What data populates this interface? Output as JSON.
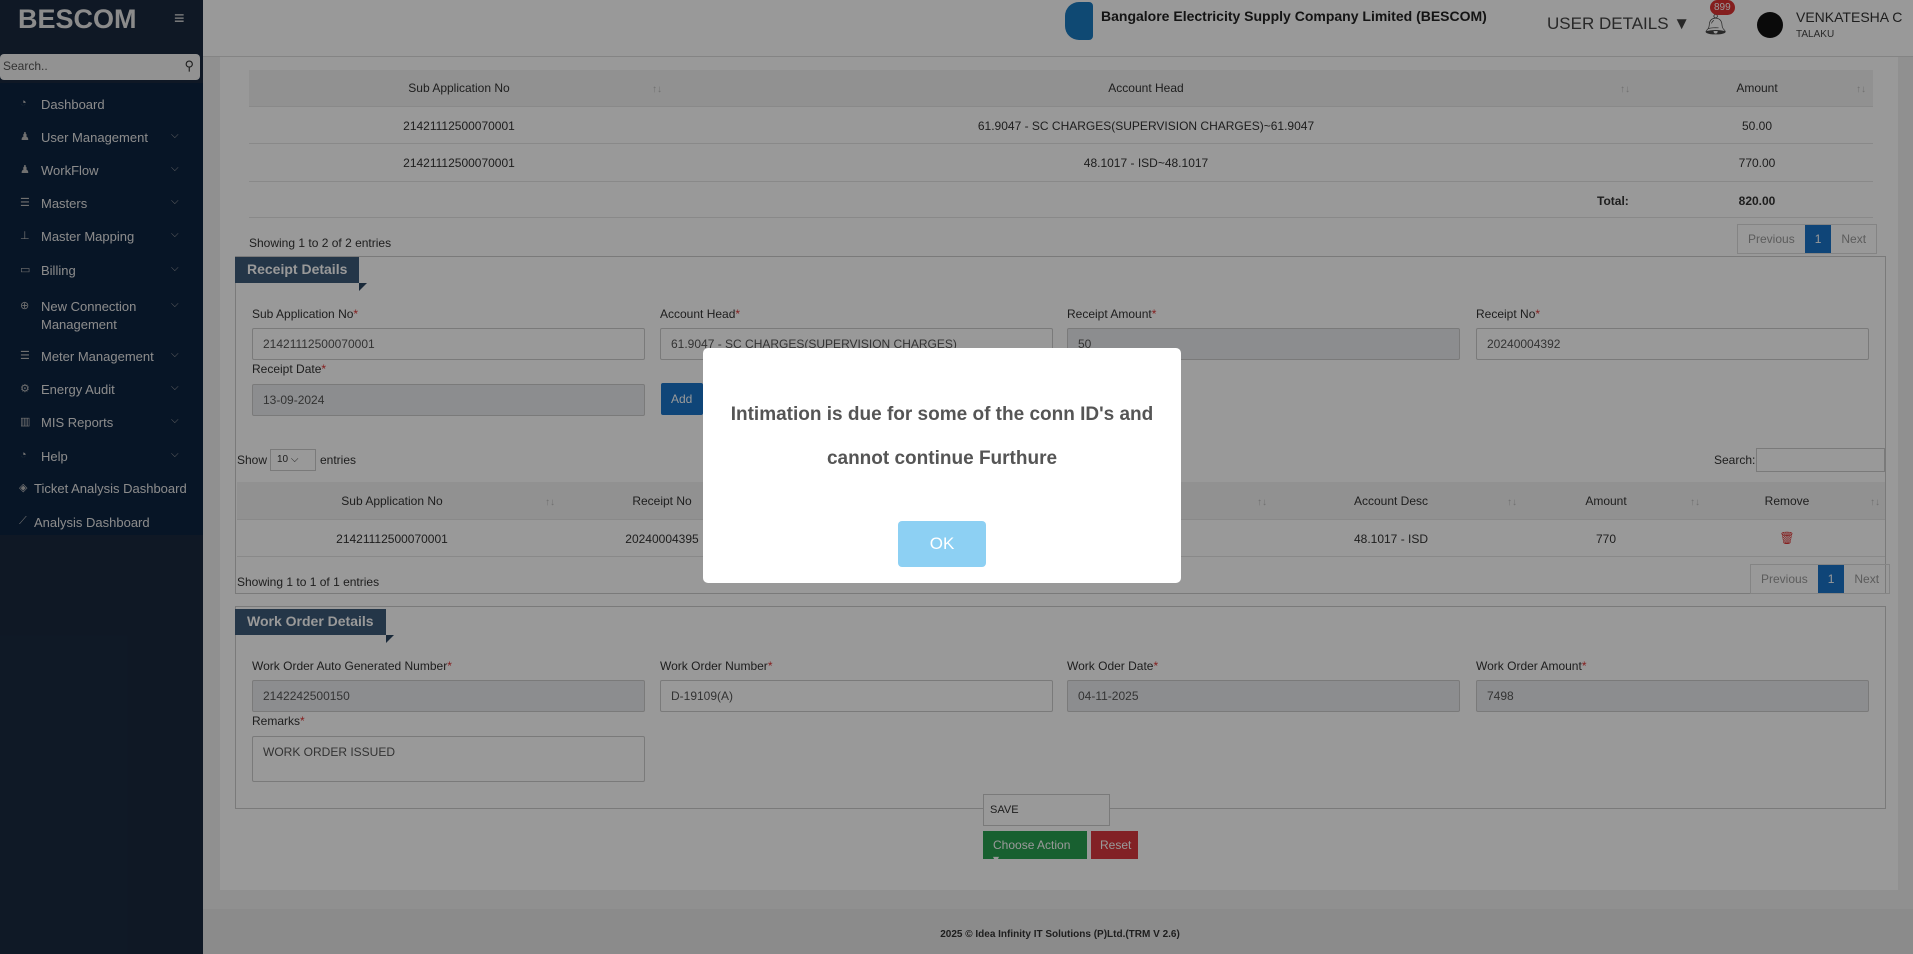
{
  "sidebar": {
    "brand": "BESCOM",
    "search_placeholder": "Search..",
    "items": [
      {
        "label": "Dashboard",
        "icon": "dashboard-icon",
        "chev": false
      },
      {
        "label": "User Management",
        "icon": "user-icon",
        "chev": true
      },
      {
        "label": "WorkFlow",
        "icon": "user-icon",
        "chev": true
      },
      {
        "label": "Masters",
        "icon": "list-icon",
        "chev": true
      },
      {
        "label": "Master Mapping",
        "icon": "sitemap-icon",
        "chev": true
      },
      {
        "label": "Billing",
        "icon": "desktop-icon",
        "chev": true
      },
      {
        "label": "New Connection",
        "label2": "Management",
        "icon": "plus-circle-icon",
        "chev": true
      },
      {
        "label": "Meter Management",
        "icon": "list-icon",
        "chev": true
      },
      {
        "label": "Energy Audit",
        "icon": "gears-icon",
        "chev": true
      },
      {
        "label": "MIS Reports",
        "icon": "bar-chart-icon",
        "chev": true
      },
      {
        "label": "Help",
        "icon": "dashboard-icon",
        "chev": true
      },
      {
        "label": "Ticket Analysis Dashboard",
        "icon": "ticket-icon",
        "chev": false
      },
      {
        "label": "Analysis Dashboard",
        "icon": "line-chart-icon",
        "chev": false
      }
    ]
  },
  "header": {
    "company": "Bangalore Electricity Supply Company Limited (BESCOM)",
    "user_details": "USER DETAILS",
    "notifications": "899",
    "user_name": "VENKATESHA C",
    "user_role": "TALAKU"
  },
  "charges_table": {
    "headers": [
      "Sub Application No",
      "Account Head",
      "Amount"
    ],
    "rows": [
      [
        "21421112500070001",
        "61.9047 - SC CHARGES(SUPERVISION CHARGES)~61.9047",
        "50.00"
      ],
      [
        "21421112500070001",
        "48.1017 - ISD~48.1017",
        "770.00"
      ]
    ],
    "total_label": "Total:",
    "total": "820.00",
    "info": "Showing 1 to 2 of 2 entries",
    "prev": "Previous",
    "page": "1",
    "next": "Next"
  },
  "receipt": {
    "title": "Receipt Details",
    "fields": [
      {
        "label": "Sub Application No",
        "value": "21421112500070001"
      },
      {
        "label": "Account Head",
        "value": "61.9047 - SC CHARGES(SUPERVISION CHARGES)"
      },
      {
        "label": "Receipt Amount",
        "value": "50"
      },
      {
        "label": "Receipt No",
        "value": "20240004392"
      }
    ],
    "date_label": "Receipt Date",
    "date_value": "13-09-2024",
    "add": "Add",
    "show": "Show",
    "length": "10",
    "entries": "entries",
    "search": "Search:",
    "headers": [
      "Sub Application No",
      "Receipt No",
      "Account Desc",
      "Amount",
      "Remove"
    ],
    "rows": [
      [
        "21421112500070001",
        "20240004395",
        "48.1017 - ISD",
        "770"
      ]
    ],
    "info": "Showing 1 to 1 of 1 entries",
    "prev": "Previous",
    "page": "1",
    "next": "Next"
  },
  "work_order": {
    "title": "Work Order Details",
    "fields": [
      {
        "label": "Work Order Auto Generated Number",
        "value": "2142242500150"
      },
      {
        "label": "Work Order Number",
        "value": "D-19109(A)"
      },
      {
        "label": "Work Oder Date",
        "value": "04-11-2025"
      },
      {
        "label": "Work Order Amount",
        "value": "7498"
      }
    ],
    "remarks_label": "Remarks",
    "remarks": "WORK ORDER ISSUED"
  },
  "actions": {
    "dropdown_item": "SAVE",
    "choose": "Choose Action",
    "reset": "Reset"
  },
  "footer": "2025 © Idea Infinity IT Solutions (P)Ltd.(TRM V 2.6)",
  "modal": {
    "line1": "Intimation is due for some of the conn ID's and",
    "line2": "cannot continue Furthure",
    "ok": "OK"
  }
}
